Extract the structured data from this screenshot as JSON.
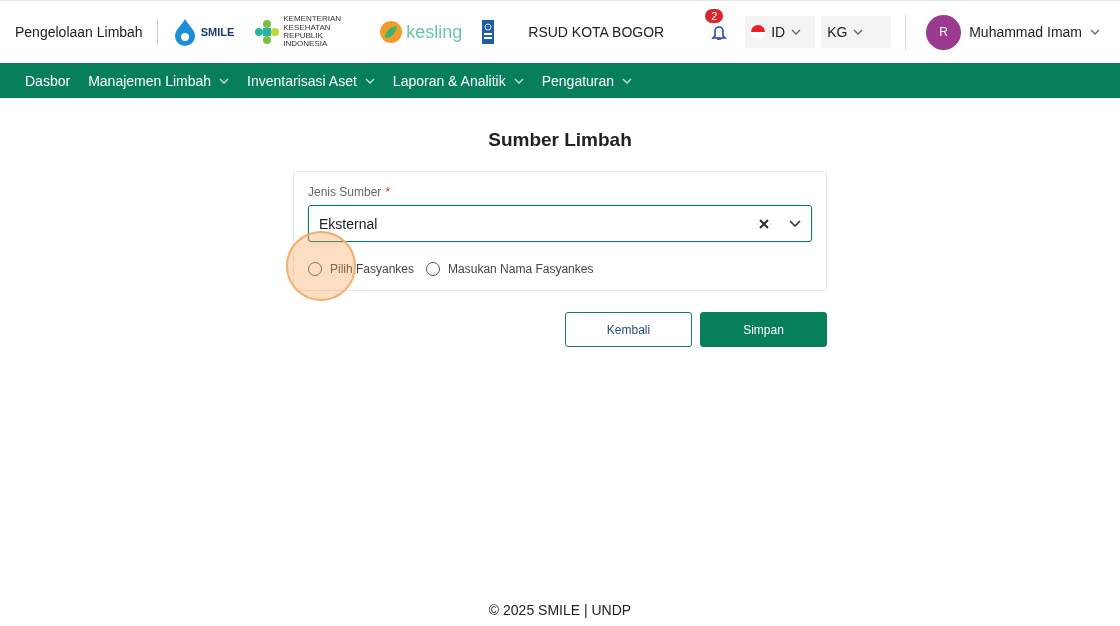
{
  "header": {
    "app_title": "Pengelolaan Limbah",
    "logos": [
      {
        "kind": "smile",
        "text": "SMILE"
      },
      {
        "kind": "kemenkes",
        "text": "KEMENTERIAN KESEHATAN REPUBLIK INDONESIA"
      },
      {
        "kind": "kesling",
        "text": "kesling"
      },
      {
        "kind": "undp"
      }
    ],
    "facility": "RSUD KOTA BOGOR",
    "notifications": {
      "count": "2"
    },
    "language": {
      "code": "ID"
    },
    "unit": {
      "code": "KG"
    },
    "user": {
      "initial": "R",
      "name": "Muhammad Imam"
    }
  },
  "nav": [
    {
      "label": "Dasbor",
      "dropdown": false
    },
    {
      "label": "Manajemen Limbah",
      "dropdown": true
    },
    {
      "label": "Inventarisasi Aset",
      "dropdown": true
    },
    {
      "label": "Laporan & Analitik",
      "dropdown": true
    },
    {
      "label": "Pengaturan",
      "dropdown": true
    }
  ],
  "page_title": "Sumber Limbah",
  "form": {
    "field_label": "Jenis Sumber",
    "required_mark": "*",
    "value": "Eksternal",
    "options": [
      {
        "label": "Pilih Fasyankes",
        "selected": false
      },
      {
        "label": "Masukan Nama Fasyankes",
        "selected": false
      }
    ]
  },
  "buttons": [
    {
      "label": "Kembali",
      "kind": "secondary"
    },
    {
      "label": "Simpan",
      "kind": "primary"
    }
  ],
  "footer": "© 2025 SMILE | UNDP"
}
